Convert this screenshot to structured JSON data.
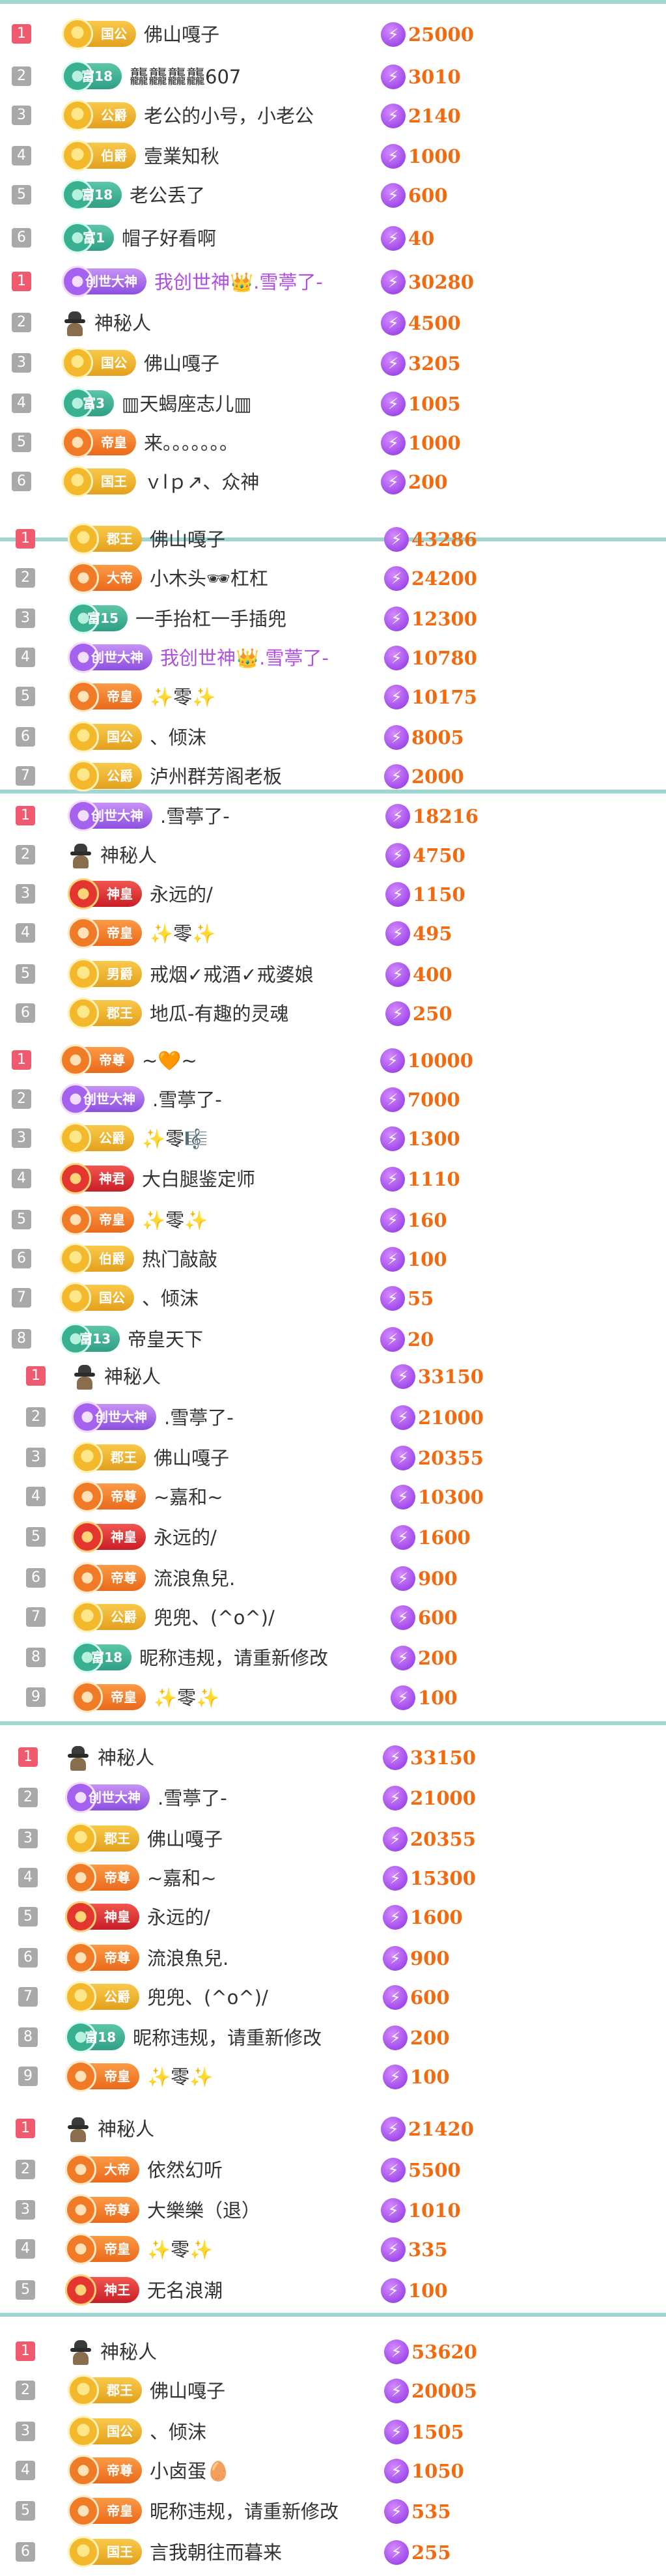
{
  "colors": {
    "rank_first": "#f05a6e",
    "rank_other": "#a9a9a9",
    "score": "#f26a0f",
    "purple_name": "#b04ee0",
    "separator": "#9fd6d2"
  },
  "icons": {
    "score": "lightning-bolt-icon",
    "mystery": "mystery-person-icon",
    "rank": "rank-box"
  },
  "sections": [
    {
      "rows": [
        {
          "rank": "1",
          "badge": {
            "label": "国公",
            "color": "gold"
          },
          "name": "佛山嘎子",
          "score": "25000"
        },
        {
          "rank": "2",
          "badge": {
            "label": "富18",
            "color": "teal"
          },
          "name": "龘龘龘龘607",
          "score": "3010"
        },
        {
          "rank": "3",
          "badge": {
            "label": "公爵",
            "color": "gold"
          },
          "name": "老公的小号，小老公",
          "score": "2140"
        },
        {
          "rank": "4",
          "badge": {
            "label": "伯爵",
            "color": "gold"
          },
          "name": "壹業知秋",
          "score": "1000"
        },
        {
          "rank": "5",
          "badge": {
            "label": "富18",
            "color": "teal"
          },
          "name": "老公丢了",
          "score": "600"
        },
        {
          "rank": "6",
          "badge": {
            "label": "富1",
            "color": "teal"
          },
          "name": "帽子好看啊",
          "score": "40"
        }
      ]
    },
    {
      "rows": [
        {
          "rank": "1",
          "badge": {
            "label": "创世大神",
            "color": "purple"
          },
          "name": "我创世神👑.雪葶了-",
          "name_purple": true,
          "score": "30280"
        },
        {
          "rank": "2",
          "badge": null,
          "name": "神秘人",
          "score": "4500"
        },
        {
          "rank": "3",
          "badge": {
            "label": "国公",
            "color": "gold"
          },
          "name": "佛山嘎子",
          "score": "3205"
        },
        {
          "rank": "4",
          "badge": {
            "label": "富3",
            "color": "teal"
          },
          "name": "▥天蝎座志儿▥",
          "score": "1005"
        },
        {
          "rank": "5",
          "badge": {
            "label": "帝皇",
            "color": "orange"
          },
          "name": "来。。。。。。。",
          "score": "1000"
        },
        {
          "rank": "6",
          "badge": {
            "label": "国王",
            "color": "gold"
          },
          "name": "ｖlｐ↗、众神",
          "score": "200"
        }
      ]
    },
    {
      "rows": [
        {
          "rank": "1",
          "badge": {
            "label": "郡王",
            "color": "gold"
          },
          "name": "佛山嘎子",
          "score": "43286"
        },
        {
          "rank": "2",
          "badge": {
            "label": "大帝",
            "color": "orange"
          },
          "name": "小木头🕶杠杠",
          "score": "24200"
        },
        {
          "rank": "3",
          "badge": {
            "label": "富15",
            "color": "teal"
          },
          "name": "一手抬杠一手插兜",
          "score": "12300"
        },
        {
          "rank": "4",
          "badge": {
            "label": "创世大神",
            "color": "purple"
          },
          "name": "我创世神👑.雪葶了-",
          "name_purple": true,
          "score": "10780"
        },
        {
          "rank": "5",
          "badge": {
            "label": "帝皇",
            "color": "orange"
          },
          "name": "✨零✨",
          "score": "10175"
        },
        {
          "rank": "6",
          "badge": {
            "label": "国公",
            "color": "gold"
          },
          "name": "、倾沫",
          "score": "8005"
        },
        {
          "rank": "7",
          "badge": {
            "label": "公爵",
            "color": "gold"
          },
          "name": "泸州群芳阁老板",
          "score": "2000"
        }
      ]
    },
    {
      "rows": [
        {
          "rank": "1",
          "badge": {
            "label": "创世大神",
            "color": "purple"
          },
          "name": ".雪葶了-",
          "score": "18216"
        },
        {
          "rank": "2",
          "badge": null,
          "name": "神秘人",
          "score": "4750"
        },
        {
          "rank": "3",
          "badge": {
            "label": "神皇",
            "color": "red"
          },
          "name": "永远的/",
          "score": "1150"
        },
        {
          "rank": "4",
          "badge": {
            "label": "帝皇",
            "color": "orange"
          },
          "name": "✨零✨",
          "score": "495"
        },
        {
          "rank": "5",
          "badge": {
            "label": "男爵",
            "color": "gold"
          },
          "name": "戒烟✓戒酒✓戒婆娘",
          "score": "400"
        },
        {
          "rank": "6",
          "badge": {
            "label": "郡王",
            "color": "gold"
          },
          "name": "地瓜-有趣的灵魂",
          "score": "250"
        }
      ]
    },
    {
      "rows": [
        {
          "rank": "1",
          "badge": {
            "label": "帝尊",
            "color": "orange"
          },
          "name": "~🧡~",
          "score": "10000"
        },
        {
          "rank": "2",
          "badge": {
            "label": "创世大神",
            "color": "purple"
          },
          "name": ".雪葶了-",
          "score": "7000"
        },
        {
          "rank": "3",
          "badge": {
            "label": "公爵",
            "color": "gold"
          },
          "name": "✨零🎼",
          "score": "1300"
        },
        {
          "rank": "4",
          "badge": {
            "label": "神君",
            "color": "red"
          },
          "name": "大白腿鉴定师",
          "score": "1110"
        },
        {
          "rank": "5",
          "badge": {
            "label": "帝皇",
            "color": "orange"
          },
          "name": "✨零✨",
          "score": "160"
        },
        {
          "rank": "6",
          "badge": {
            "label": "伯爵",
            "color": "gold"
          },
          "name": "热门敲敲",
          "score": "100"
        },
        {
          "rank": "7",
          "badge": {
            "label": "国公",
            "color": "gold"
          },
          "name": "、倾沫",
          "score": "55"
        },
        {
          "rank": "8",
          "badge": {
            "label": "富13",
            "color": "teal"
          },
          "name": "帝皇天下",
          "score": "20"
        }
      ]
    },
    {
      "rows": [
        {
          "rank": "1",
          "badge": null,
          "name": "神秘人",
          "score": "33150"
        },
        {
          "rank": "2",
          "badge": {
            "label": "创世大神",
            "color": "purple"
          },
          "name": ".雪葶了-",
          "score": "21000"
        },
        {
          "rank": "3",
          "badge": {
            "label": "郡王",
            "color": "gold"
          },
          "name": "佛山嘎子",
          "score": "20355"
        },
        {
          "rank": "4",
          "badge": {
            "label": "帝尊",
            "color": "orange"
          },
          "name": "~嘉和~",
          "score": "10300"
        },
        {
          "rank": "5",
          "badge": {
            "label": "神皇",
            "color": "red"
          },
          "name": "永远的/",
          "score": "1600"
        },
        {
          "rank": "6",
          "badge": {
            "label": "帝尊",
            "color": "orange"
          },
          "name": "流浪魚兒.",
          "score": "900"
        },
        {
          "rank": "7",
          "badge": {
            "label": "公爵",
            "color": "gold"
          },
          "name": "兜兜、(^o^)/",
          "score": "600"
        },
        {
          "rank": "8",
          "badge": {
            "label": "富18",
            "color": "teal"
          },
          "name": "昵称违规，请重新修改",
          "score": "200"
        },
        {
          "rank": "9",
          "badge": {
            "label": "帝皇",
            "color": "orange"
          },
          "name": "✨零✨",
          "score": "100"
        }
      ]
    },
    {
      "rows": [
        {
          "rank": "1",
          "badge": null,
          "name": "神秘人",
          "score": "33150"
        },
        {
          "rank": "2",
          "badge": {
            "label": "创世大神",
            "color": "purple"
          },
          "name": ".雪葶了-",
          "score": "21000"
        },
        {
          "rank": "3",
          "badge": {
            "label": "郡王",
            "color": "gold"
          },
          "name": "佛山嘎子",
          "score": "20355"
        },
        {
          "rank": "4",
          "badge": {
            "label": "帝尊",
            "color": "orange"
          },
          "name": "~嘉和~",
          "score": "15300"
        },
        {
          "rank": "5",
          "badge": {
            "label": "神皇",
            "color": "red"
          },
          "name": "永远的/",
          "score": "1600"
        },
        {
          "rank": "6",
          "badge": {
            "label": "帝尊",
            "color": "orange"
          },
          "name": "流浪魚兒.",
          "score": "900"
        },
        {
          "rank": "7",
          "badge": {
            "label": "公爵",
            "color": "gold"
          },
          "name": "兜兜、(^o^)/",
          "score": "600"
        },
        {
          "rank": "8",
          "badge": {
            "label": "富18",
            "color": "teal"
          },
          "name": "昵称违规，请重新修改",
          "score": "200"
        },
        {
          "rank": "9",
          "badge": {
            "label": "帝皇",
            "color": "orange"
          },
          "name": "✨零✨",
          "score": "100"
        }
      ]
    },
    {
      "rows": [
        {
          "rank": "1",
          "badge": null,
          "name": "神秘人",
          "score": "21420"
        },
        {
          "rank": "2",
          "badge": {
            "label": "大帝",
            "color": "orange"
          },
          "name": "依然幻听",
          "score": "5500"
        },
        {
          "rank": "3",
          "badge": {
            "label": "帝尊",
            "color": "orange"
          },
          "name": "大樂樂（退）",
          "score": "1010"
        },
        {
          "rank": "4",
          "badge": {
            "label": "帝皇",
            "color": "orange"
          },
          "name": "✨零✨",
          "score": "335"
        },
        {
          "rank": "5",
          "badge": {
            "label": "神王",
            "color": "red"
          },
          "name": "无名浪潮",
          "score": "100"
        }
      ]
    },
    {
      "rows": [
        {
          "rank": "1",
          "badge": null,
          "name": "神秘人",
          "score": "53620"
        },
        {
          "rank": "2",
          "badge": {
            "label": "郡王",
            "color": "gold"
          },
          "name": "佛山嘎子",
          "score": "20005"
        },
        {
          "rank": "3",
          "badge": {
            "label": "国公",
            "color": "gold"
          },
          "name": "、倾沫",
          "score": "1505"
        },
        {
          "rank": "4",
          "badge": {
            "label": "帝尊",
            "color": "orange"
          },
          "name": "小卤蛋🥚",
          "score": "1050"
        },
        {
          "rank": "5",
          "badge": {
            "label": "帝皇",
            "color": "orange"
          },
          "name": "昵称违规，请重新修改",
          "score": "535"
        },
        {
          "rank": "6",
          "badge": {
            "label": "国王",
            "color": "gold"
          },
          "name": "言我朝往而暮来",
          "score": "255"
        }
      ]
    }
  ]
}
